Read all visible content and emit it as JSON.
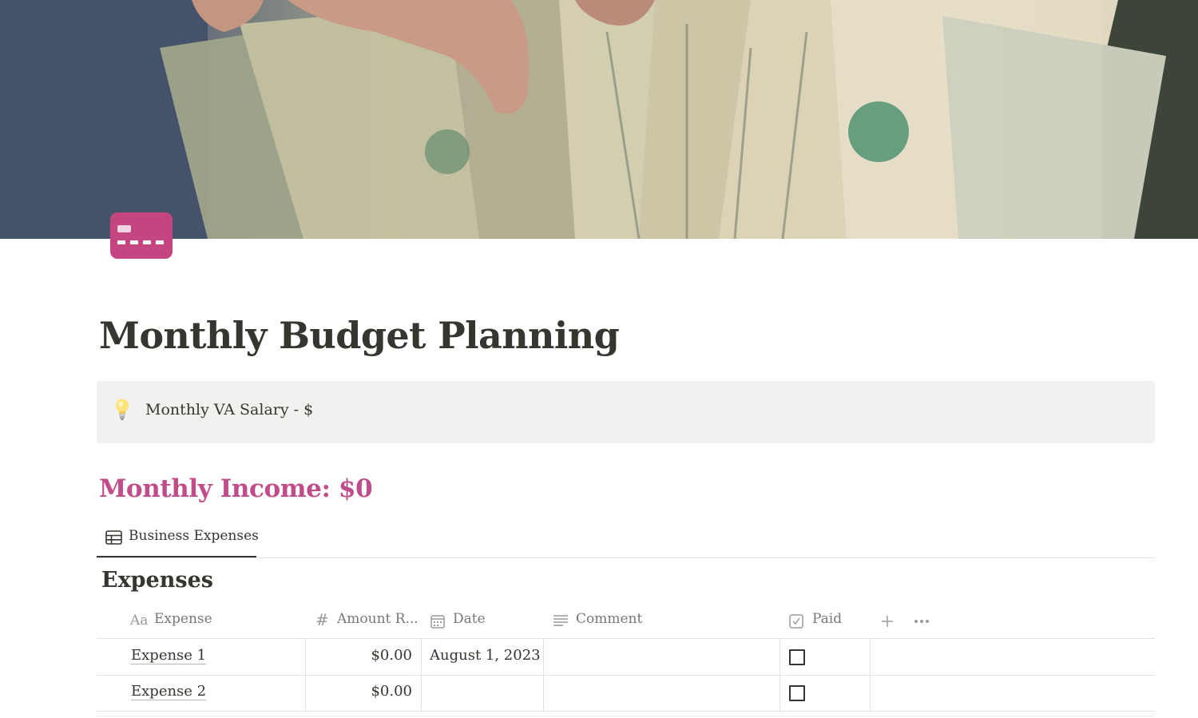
{
  "cover": {
    "image": "cover-photo-hundred-dollar-bills"
  },
  "page": {
    "icon": "credit-card-icon",
    "icon_color": "#c4457f",
    "title": "Monthly Budget Planning"
  },
  "callout": {
    "icon": "lightbulb-icon",
    "text": "Monthly VA Salary - $"
  },
  "income_heading": "Monthly Income: $0",
  "income_color": "#c14c8a",
  "view_tabs": [
    {
      "icon": "table-icon",
      "label": "Business Expenses",
      "active": true
    }
  ],
  "database": {
    "title": "Expenses",
    "columns": [
      {
        "icon": "text-property-icon",
        "icon_text": "Aa",
        "label": "Expense"
      },
      {
        "icon": "number-property-icon",
        "icon_text": "#",
        "label": "Amount R..."
      },
      {
        "icon": "calendar-icon",
        "label": "Date"
      },
      {
        "icon": "lines-icon",
        "label": "Comment"
      },
      {
        "icon": "checkbox-property-icon",
        "label": "Paid"
      }
    ],
    "add_column_icon": "plus-icon",
    "more_icon": "more-icon",
    "rows": [
      {
        "expense": "Expense 1",
        "amount": "$0.00",
        "date": "August 1, 2023",
        "comment": "",
        "paid": false
      },
      {
        "expense": "Expense 2",
        "amount": "$0.00",
        "date": "",
        "comment": "",
        "paid": false
      }
    ]
  }
}
